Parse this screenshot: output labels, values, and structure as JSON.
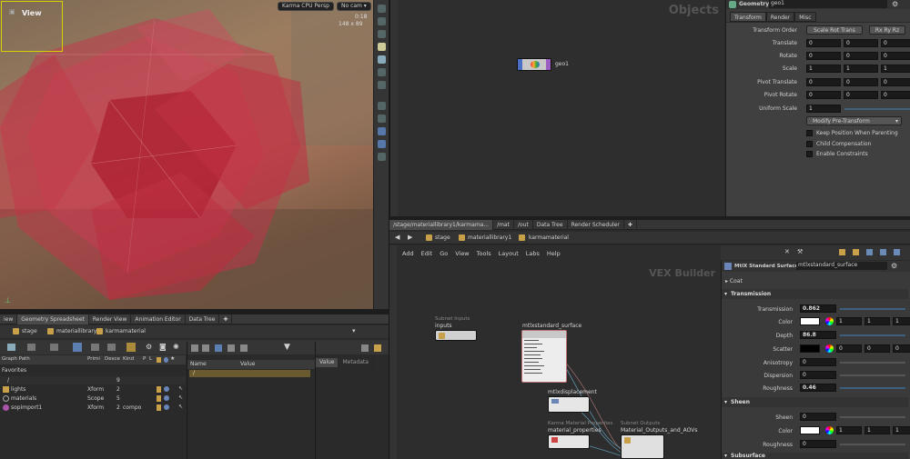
{
  "viewport": {
    "label": "View",
    "camera_menu": "Karma CPU  Persp",
    "cam_menu": "No cam",
    "stat1": "0:18",
    "stat2": "148 x 89"
  },
  "objects_pane": {
    "title": "Objects",
    "node_name": "geo1"
  },
  "geo_params": {
    "type_label": "Geometry",
    "name": "geo1",
    "tabs": [
      "Transform",
      "Render",
      "Misc"
    ],
    "transform_order_label": "Transform Order",
    "transform_order": "Scale Rot Trans",
    "rot_order": "Rx Ry Rz",
    "rows": [
      {
        "label": "Translate",
        "v": [
          "0",
          "0",
          "0"
        ]
      },
      {
        "label": "Rotate",
        "v": [
          "0",
          "0",
          "0"
        ]
      },
      {
        "label": "Scale",
        "v": [
          "1",
          "1",
          "1"
        ]
      },
      {
        "label": "Pivot Translate",
        "v": [
          "0",
          "0",
          "0"
        ]
      },
      {
        "label": "Pivot Rotate",
        "v": [
          "0",
          "0",
          "0"
        ]
      }
    ],
    "uniform_scale_label": "Uniform Scale",
    "uniform_scale": "1",
    "modify_menu": "Modify Pre-Transform",
    "checks": [
      "Keep Position When Parenting",
      "Child Compensation",
      "Enable Constraints"
    ]
  },
  "network_tabs": [
    "/stage/materiallibrary1/karmama...",
    "/mat",
    "/out",
    "Data Tree",
    "Render Scheduler"
  ],
  "vex_path": [
    "stage",
    "materiallibrary1",
    "karmamaterial"
  ],
  "vex_menu": [
    "Add",
    "Edit",
    "Go",
    "View",
    "Tools",
    "Layout",
    "Labs",
    "Help"
  ],
  "vex_title": "VEX Builder",
  "vex_nodes": {
    "subnet_inputs_title": "Subnet Inputs",
    "subnet_inputs": "inputs",
    "standard_surface": "mtlxstandard_surface",
    "displacement": "mtlxdisplacement",
    "karma_props_title": "Karma Material Properties",
    "karma_props": "material_properties",
    "subnet_outputs_title": "Subnet Outputs",
    "subnet_outputs": "Material_Outputs_and_AOVs"
  },
  "mtlx_params": {
    "type_label": "MtlX Standard Surface",
    "name": "mtlxstandard_surface",
    "coat_label": "Coat",
    "transmission_section": "Transmission",
    "transmission": [
      {
        "label": "Transmission",
        "value": "0.862"
      },
      {
        "label": "Color",
        "value": "",
        "rgb": [
          "1",
          "1",
          "1"
        ]
      },
      {
        "label": "Depth",
        "value": "86.8"
      },
      {
        "label": "Scatter",
        "value": "",
        "rgb": [
          "0",
          "0",
          "0"
        ]
      },
      {
        "label": "Anisotropy",
        "value": "0"
      },
      {
        "label": "Dispersion",
        "value": "0"
      },
      {
        "label": "Roughness",
        "value": "0.46"
      }
    ],
    "sheen_section": "Sheen",
    "sheen": [
      {
        "label": "Sheen",
        "value": "0"
      },
      {
        "label": "Color",
        "value": "",
        "rgb": [
          "1",
          "1",
          "1"
        ]
      },
      {
        "label": "Roughness",
        "value": "0"
      }
    ],
    "subsurface_label": "Subsurface"
  },
  "bottom_tabs": [
    "iew",
    "Geometry Spreadsheet",
    "Render View",
    "Animation Editor",
    "Data Tree"
  ],
  "scene_path": [
    "stage",
    "materiallibrary1",
    "karmamaterial"
  ],
  "scene_graph": {
    "headers": [
      "Graph Path",
      "Primi",
      "Desce",
      "Kind",
      "P",
      "L"
    ],
    "favorites": "Favorites",
    "rows": [
      {
        "path": "/",
        "prim": "",
        "desc": "9",
        "kind": ""
      },
      {
        "path": "lights",
        "prim": "Xform",
        "desc": "2",
        "kind": ""
      },
      {
        "path": "materials",
        "prim": "Scope",
        "desc": "5",
        "kind": ""
      },
      {
        "path": "sopimport1",
        "prim": "Xform",
        "desc": "2",
        "kind": "compo"
      }
    ]
  },
  "props_table": {
    "headers": [
      "Name",
      "Value"
    ],
    "first_row": "/"
  },
  "value_panel": {
    "tabs": [
      "Value",
      "Metadata"
    ]
  }
}
